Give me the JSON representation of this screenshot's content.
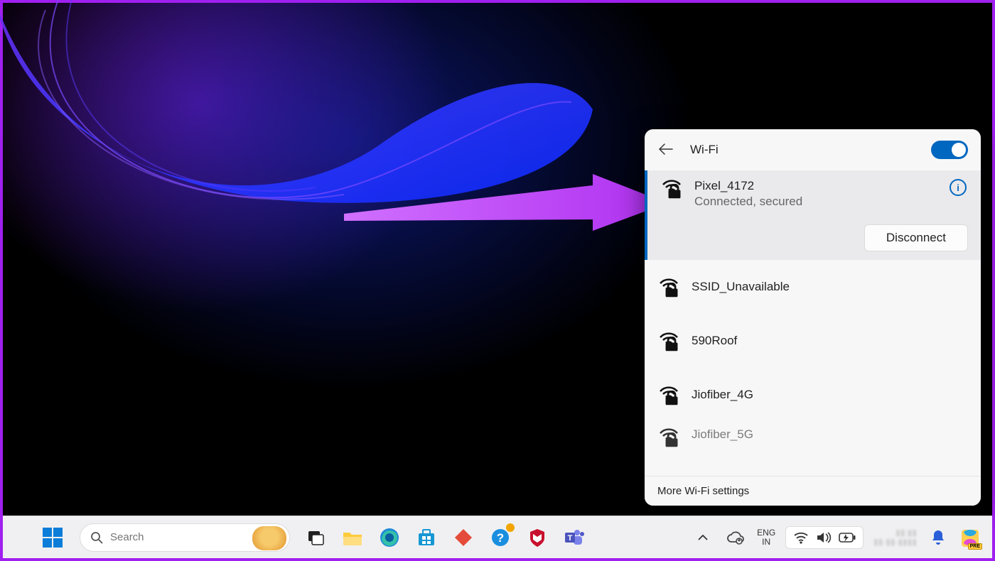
{
  "wifi_panel": {
    "title": "Wi-Fi",
    "toggle_on": true,
    "connected": {
      "name": "Pixel_4172",
      "status": "Connected, secured",
      "disconnect_label": "Disconnect"
    },
    "networks": [
      {
        "name": "SSID_Unavailable"
      },
      {
        "name": "590Roof"
      },
      {
        "name": "Jiofiber_4G"
      },
      {
        "name": "Jiofiber_5G"
      }
    ],
    "more_settings": "More Wi-Fi settings"
  },
  "taskbar": {
    "search_placeholder": "Search",
    "language": {
      "line1": "ENG",
      "line2": "IN"
    },
    "pinned": [
      "task-view",
      "file-explorer",
      "edge",
      "microsoft-store",
      "todoist",
      "get-help",
      "mcafee",
      "teams"
    ]
  },
  "colors": {
    "accent": "#0067c0",
    "arrow": "#b030f0"
  }
}
